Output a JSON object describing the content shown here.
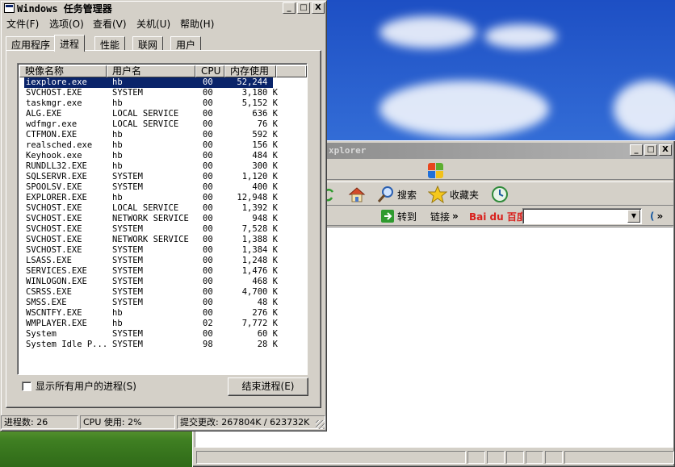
{
  "colors": {
    "selection": "#0a246a",
    "window_face": "#d4d0c8",
    "desktop_sky": "#3a76dc"
  },
  "task_manager": {
    "title": "Windows 任务管理器",
    "title_buttons": {
      "minimize": "_",
      "maximize": "□",
      "close": "X"
    },
    "menu": [
      "文件(F)",
      "选项(O)",
      "查看(V)",
      "关机(U)",
      "帮助(H)"
    ],
    "tabs": [
      "应用程序",
      "进程",
      "性能",
      "联网",
      "用户"
    ],
    "active_tab": "进程",
    "columns": [
      "映像名称",
      "用户名",
      "CPU",
      "内存使用"
    ],
    "processes": [
      {
        "name": "iexplore.exe",
        "user": "hb",
        "cpu": "00",
        "mem": "52,244 K",
        "selected": true
      },
      {
        "name": "SVCHOST.EXE",
        "user": "SYSTEM",
        "cpu": "00",
        "mem": "3,180 K"
      },
      {
        "name": "taskmgr.exe",
        "user": "hb",
        "cpu": "00",
        "mem": "5,152 K"
      },
      {
        "name": "ALG.EXE",
        "user": "LOCAL SERVICE",
        "cpu": "00",
        "mem": "636 K"
      },
      {
        "name": "wdfmgr.exe",
        "user": "LOCAL SERVICE",
        "cpu": "00",
        "mem": "76 K"
      },
      {
        "name": "CTFMON.EXE",
        "user": "hb",
        "cpu": "00",
        "mem": "592 K"
      },
      {
        "name": "realsched.exe",
        "user": "hb",
        "cpu": "00",
        "mem": "156 K"
      },
      {
        "name": "Keyhook.exe",
        "user": "hb",
        "cpu": "00",
        "mem": "484 K"
      },
      {
        "name": "RUNDLL32.EXE",
        "user": "hb",
        "cpu": "00",
        "mem": "300 K"
      },
      {
        "name": "SQLSERVR.EXE",
        "user": "SYSTEM",
        "cpu": "00",
        "mem": "1,120 K"
      },
      {
        "name": "SPOOLSV.EXE",
        "user": "SYSTEM",
        "cpu": "00",
        "mem": "400 K"
      },
      {
        "name": "EXPLORER.EXE",
        "user": "hb",
        "cpu": "00",
        "mem": "12,948 K"
      },
      {
        "name": "SVCHOST.EXE",
        "user": "LOCAL SERVICE",
        "cpu": "00",
        "mem": "1,392 K"
      },
      {
        "name": "SVCHOST.EXE",
        "user": "NETWORK SERVICE",
        "cpu": "00",
        "mem": "948 K"
      },
      {
        "name": "SVCHOST.EXE",
        "user": "SYSTEM",
        "cpu": "00",
        "mem": "7,528 K"
      },
      {
        "name": "SVCHOST.EXE",
        "user": "NETWORK SERVICE",
        "cpu": "00",
        "mem": "1,388 K"
      },
      {
        "name": "SVCHOST.EXE",
        "user": "SYSTEM",
        "cpu": "00",
        "mem": "1,384 K"
      },
      {
        "name": "LSASS.EXE",
        "user": "SYSTEM",
        "cpu": "00",
        "mem": "1,248 K"
      },
      {
        "name": "SERVICES.EXE",
        "user": "SYSTEM",
        "cpu": "00",
        "mem": "1,476 K"
      },
      {
        "name": "WINLOGON.EXE",
        "user": "SYSTEM",
        "cpu": "00",
        "mem": "468 K"
      },
      {
        "name": "CSRSS.EXE",
        "user": "SYSTEM",
        "cpu": "00",
        "mem": "4,700 K"
      },
      {
        "name": "SMSS.EXE",
        "user": "SYSTEM",
        "cpu": "00",
        "mem": "48 K"
      },
      {
        "name": "WSCNTFY.EXE",
        "user": "hb",
        "cpu": "00",
        "mem": "276 K"
      },
      {
        "name": "WMPLAYER.EXE",
        "user": "hb",
        "cpu": "02",
        "mem": "7,772 K"
      },
      {
        "name": "System",
        "user": "SYSTEM",
        "cpu": "00",
        "mem": "60 K"
      },
      {
        "name": "System Idle P...",
        "user": "SYSTEM",
        "cpu": "98",
        "mem": "28 K"
      }
    ],
    "show_all_users_label": "显示所有用户的进程(S)",
    "show_all_users_checked": false,
    "end_process_label": "结束进程(E)",
    "status": {
      "process_count": "进程数: 26",
      "cpu_usage": "CPU 使用: 2%",
      "commit_charge": "提交更改: 267804K / 623732K"
    }
  },
  "ie_window": {
    "title_fragment": "xplorer",
    "title_buttons": {
      "minimize": "_",
      "maximize": "□",
      "close": "X"
    },
    "toolbar": {
      "search_label": "搜索",
      "favorites_label": "收藏夹"
    },
    "address_bar": {
      "go_label": "转到",
      "links_label": "链接",
      "chevron": "»",
      "baidu_logo": "Bai du 百度",
      "baidu_dropdown": "▾",
      "chevron_right": "»"
    },
    "icons": [
      "refresh-icon",
      "home-icon",
      "search-icon",
      "favorites-star-icon",
      "history-icon",
      "windows-flag-icon",
      "go-arrow-icon"
    ]
  }
}
